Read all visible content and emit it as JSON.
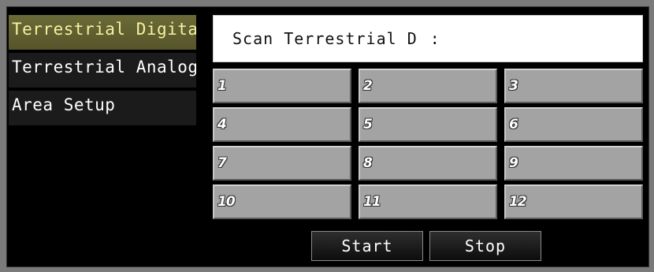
{
  "sidebar": {
    "items": [
      {
        "label": "Terrestrial Digital",
        "active": true
      },
      {
        "label": "Terrestrial Analog",
        "active": false
      },
      {
        "label": "Area Setup",
        "active": false
      }
    ]
  },
  "scan": {
    "label": "Scan Terrestrial D",
    "separator": ":",
    "value": ""
  },
  "channels": [
    "1",
    "2",
    "3",
    "4",
    "5",
    "6",
    "7",
    "8",
    "9",
    "10",
    "11",
    "12"
  ],
  "buttons": {
    "start_label": "Start",
    "stop_label": "Stop"
  },
  "colors": {
    "active_item_bg": "#5f5e30",
    "active_item_text": "#f6f2a0",
    "cell_bg": "#a3a3a3",
    "screen_bg": "#000000"
  }
}
